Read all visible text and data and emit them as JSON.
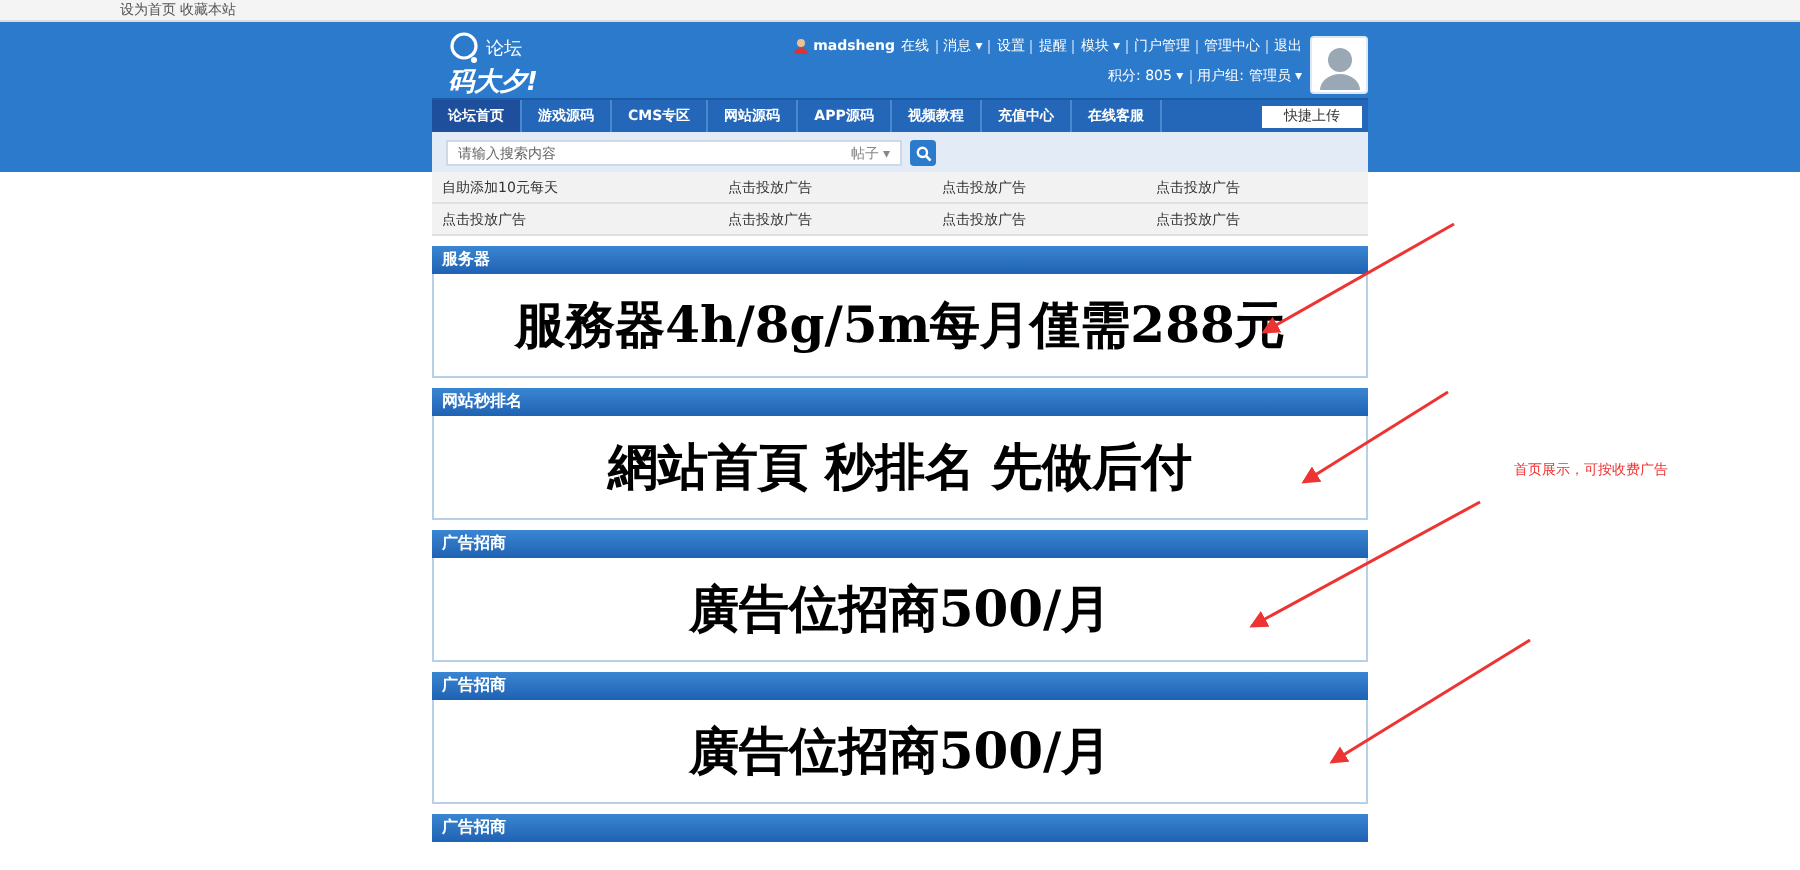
{
  "top_bar": {
    "text": "设为首页 收藏本站"
  },
  "header": {
    "logo_small": "论坛",
    "logo_big": "码大夕!",
    "user": {
      "name": "madsheng",
      "links": [
        "在线",
        "消息 ▾",
        "设置",
        "提醒",
        "模块 ▾",
        "门户管理",
        "管理中心",
        "退出"
      ],
      "credits": "积分: 805 ▾",
      "group": "用户组: 管理员 ▾"
    }
  },
  "nav": {
    "items": [
      {
        "label": "论坛首页",
        "selected": true
      },
      {
        "label": "游戏源码",
        "selected": false
      },
      {
        "label": "CMS专区",
        "selected": false
      },
      {
        "label": "网站源码",
        "selected": false
      },
      {
        "label": "APP源码",
        "selected": false
      },
      {
        "label": "视频教程",
        "selected": false
      },
      {
        "label": "充值中心",
        "selected": false
      },
      {
        "label": "在线客服",
        "selected": false
      }
    ],
    "quick_button": "快捷上传"
  },
  "search": {
    "placeholder": "请输入搜索内容",
    "scope": "帖子 ▾"
  },
  "ad_links": [
    [
      "自助添加10元每天",
      "点击投放广告",
      "点击投放广告",
      "点击投放广告"
    ],
    [
      "点击投放广告",
      "点击投放广告",
      "点击投放广告",
      "点击投放广告"
    ]
  ],
  "sections": [
    {
      "title": "服务器",
      "banner": "服務器4h/8g/5m每月僅需288元"
    },
    {
      "title": "网站秒排名",
      "banner": "網站首頁 秒排名 先做后付"
    },
    {
      "title": "广告招商",
      "banner": "廣告位招商500/月"
    },
    {
      "title": "广告招商",
      "banner": "廣告位招商500/月"
    },
    {
      "title": "广告招商"
    }
  ],
  "annotation": "首页展示，可按收费广告"
}
